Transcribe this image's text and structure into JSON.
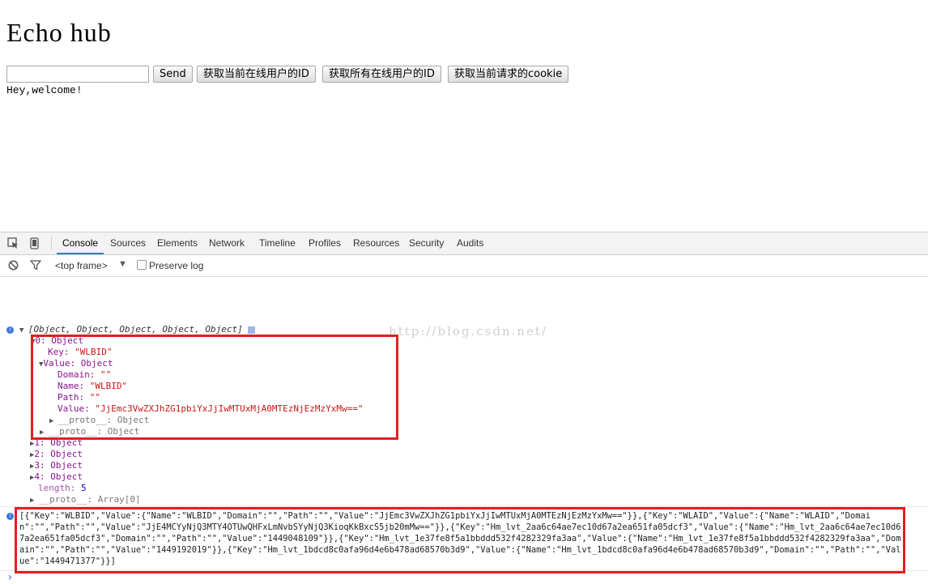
{
  "page": {
    "title": "Echo hub",
    "input_value": "",
    "send_label": "Send",
    "btn_online_id": "获取当前在线用户的ID",
    "btn_all_online_ids": "获取所有在线用户的ID",
    "btn_cookie": "获取当前请求的cookie",
    "welcome": "Hey,welcome!"
  },
  "devtools": {
    "tabs": [
      "Console",
      "Sources",
      "Elements",
      "Network",
      "Timeline",
      "Profiles",
      "Resources",
      "Security",
      "Audits"
    ],
    "active_tab": "Console",
    "frame_select": "<top frame>",
    "preserve_log": "Preserve log",
    "watermark": "http://blog.csdn.net/",
    "tree": {
      "summary": "[Object, Object, Object, Object, Object]",
      "item0": "0: Object",
      "key_name": "Key: ",
      "key_value": "\"WLBID\"",
      "value_label": "Value: Object",
      "domain_name": "Domain: ",
      "domain_value": "\"\"",
      "name_name": "Name: ",
      "name_value": "\"WLBID\"",
      "path_name": "Path: ",
      "path_value": "\"\"",
      "value_name": "Value: ",
      "value_value": "\"JjEmc3VwZXJhZG1pbiYxJjIwMTUxMjA0MTEzNjEzMzYxMw==\"",
      "proto_inner": "__proto__: Object",
      "proto_outer": "__proto__: Object",
      "item1": "1: Object",
      "item2": "2: Object",
      "item3": "3: Object",
      "item4": "4: Object",
      "length_name": "length: ",
      "length_value": "5",
      "proto_array": "__proto__: Array[0]"
    },
    "json_output": "[{\"Key\":\"WLBID\",\"Value\":{\"Name\":\"WLBID\",\"Domain\":\"\",\"Path\":\"\",\"Value\":\"JjEmc3VwZXJhZG1pbiYxJjIwMTUxMjA0MTEzNjEzMzYxMw==\"}},{\"Key\":\"WLAID\",\"Value\":{\"Name\":\"WLAID\",\"Domain\":\"\",\"Path\":\"\",\"Value\":\"JjE4MCYyNjQ3MTY4OTUwQHFxLmNvbSYyNjQ3KioqKkBxcS5jb20mMw==\"}},{\"Key\":\"Hm_lvt_2aa6c64ae7ec10d67a2ea651fa05dcf3\",\"Value\":{\"Name\":\"Hm_lvt_2aa6c64ae7ec10d67a2ea651fa05dcf3\",\"Domain\":\"\",\"Path\":\"\",\"Value\":\"1449048109\"}},{\"Key\":\"Hm_lvt_1e37fe8f5a1bbddd532f4282329fa3aa\",\"Value\":{\"Name\":\"Hm_lvt_1e37fe8f5a1bbddd532f4282329fa3aa\",\"Domain\":\"\",\"Path\":\"\",\"Value\":\"1449192019\"}},{\"Key\":\"Hm_lvt_1bdcd8c0afa96d4e6b478ad68570b3d9\",\"Value\":{\"Name\":\"Hm_lvt_1bdcd8c0afa96d4e6b478ad68570b3d9\",\"Domain\":\"\",\"Path\":\"\",\"Value\":\"1449471377\"}}]",
    "prompt": "›"
  },
  "colors": {
    "highlight_box": "#e02020",
    "active_tab": "#3879d9"
  }
}
